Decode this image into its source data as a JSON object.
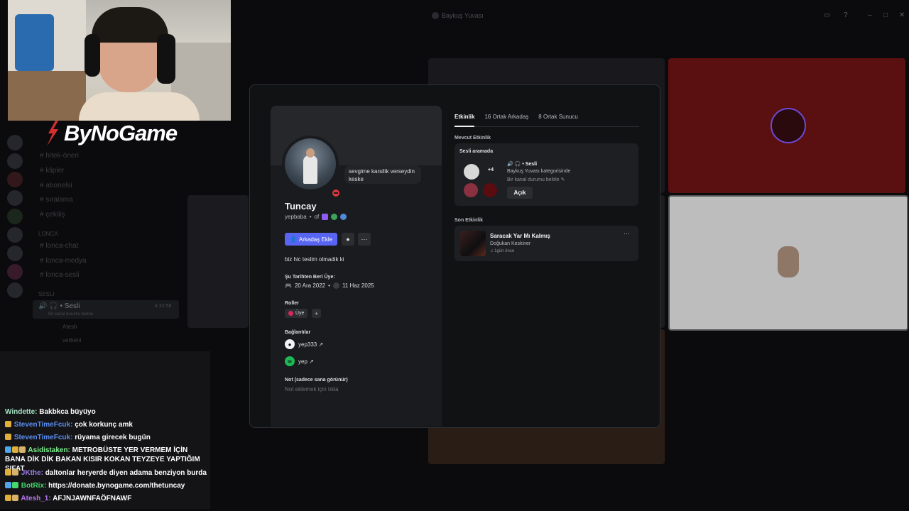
{
  "window": {
    "title": "Baykuş Yuvası"
  },
  "stream": {
    "logo_text": "ByNoGame"
  },
  "sidebar": {
    "channels": [
      "hitek-öneri",
      "klipler",
      "abonelsi",
      "sıralama",
      "çekiliş"
    ],
    "section_lonca": "LONCA",
    "lonca_channels": [
      "lonca-chat",
      "lonca-medya",
      "lonca-sesli"
    ],
    "section_sesli": "sesli",
    "voice_channel": "• Sesli",
    "voice_time": "4:32:58",
    "voice_status": "Bir kanal durumu belirle",
    "voice_users": [
      "Atesh",
      "verbeni"
    ]
  },
  "chat": {
    "messages": [
      {
        "user": "Windette:",
        "text": "Bakbkca büyüyo",
        "color": "#a6e3c4",
        "badges": []
      },
      {
        "user": "StevenTimeFcuk:",
        "text": "çok korkunç amk",
        "color": "#5b8def",
        "badges": [
          "#e0b03a"
        ]
      },
      {
        "user": "StevenTimeFcuk:",
        "text": "rüyama girecek bugün",
        "color": "#5b8def",
        "badges": [
          "#e0b03a"
        ]
      },
      {
        "user": "Asidistaken:",
        "text": "METROBÜSTE YER VERMEM İÇİN BANA DİK DİK BAKAN KISIR KOKAN TEYZEYE YAPTIĞIM SIFAT",
        "color": "#7cf28d",
        "badges": [
          "#4fa6e8",
          "#e0b03a",
          "#d7b46a"
        ]
      },
      {
        "user": "JKthe:",
        "text": "daltonlar heryerde diyen adama benziyon burda",
        "color": "#9a7dea",
        "badges": [
          "#e0b03a",
          "#d7b46a"
        ]
      },
      {
        "user": "BotRix:",
        "text": "https://donate.bynogame.com/thetuncay",
        "color": "#45d86c",
        "badges": [
          "#4fa6e8",
          "#45d86c"
        ]
      },
      {
        "user": "Atesh_1:",
        "text": "AFJNJAWNFAÖFNAWF",
        "color": "#b675f0",
        "badges": [
          "#e0b03a",
          "#d7b46a"
        ]
      }
    ]
  },
  "profile": {
    "status_text": "sevgime karsilik verseydin keske",
    "name": "Tuncay",
    "username": "yepbaba",
    "tag": "of",
    "add_friend": "Arkadaş Ekle",
    "bio": "biz hic teslim olmadik ki",
    "member_since_label": "Şu Tarihten Beri Üye:",
    "member_since_discord": "20 Ara 2022",
    "member_since_server": "11 Haz 2025",
    "roles_label": "Roller",
    "role": "Üye",
    "role_color": "#e0245e",
    "connections_label": "Bağlantılar",
    "connections": [
      {
        "icon": "github-icon",
        "name": "yep333 ↗"
      },
      {
        "icon": "spotify-icon",
        "name": "yep ↗"
      }
    ],
    "note_label": "Not (sadece sana görünür)",
    "note_placeholder": "Not eklemek için tıkla"
  },
  "tabs": [
    {
      "label": "Etkinlik",
      "active": true
    },
    {
      "label": "16 Ortak Arkadaş",
      "active": false
    },
    {
      "label": "8 Ortak Sunucu",
      "active": false
    }
  ],
  "activity": {
    "current_label": "Mevcut Etkinlik",
    "card_title": "Sesli aramada",
    "extra_count": "+4",
    "channel": "• Sesli",
    "category": "Baykuş Yuvası kategorisinde",
    "status_hint": "Bir kanal durumu belirle",
    "open_button": "Açık",
    "recent_label": "Son Etkinlik",
    "song_title": "Saracak Yar Mı Kalmış",
    "song_artist": "Doğukan Keskiner",
    "song_time": "1gün önce"
  },
  "colors": {
    "accent": "#5865f2",
    "dnd": "#da373c"
  }
}
